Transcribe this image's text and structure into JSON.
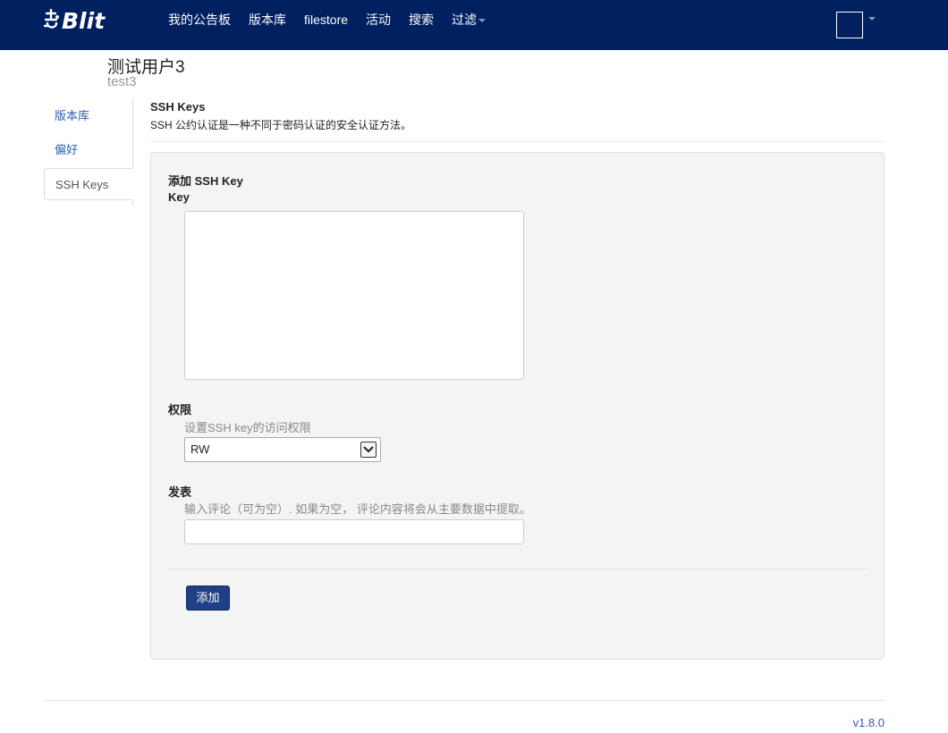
{
  "navbar": {
    "brand": "Blit",
    "items": [
      {
        "label": "我的公告板"
      },
      {
        "label": "版本库"
      },
      {
        "label": "filestore"
      },
      {
        "label": "活动"
      },
      {
        "label": "搜索"
      },
      {
        "label": "过滤"
      }
    ],
    "caret_color": "#8a97b8",
    "background": "#002060"
  },
  "user": {
    "display_name": "测试用户3",
    "username": "test3"
  },
  "side_tabs": [
    {
      "label": "版本库",
      "active": false
    },
    {
      "label": "偏好",
      "active": false
    },
    {
      "label": "SSH Keys",
      "active": true
    }
  ],
  "section": {
    "title": "SSH Keys",
    "description": "SSH 公约认证是一种不同于密码认证的安全认证方法。"
  },
  "form": {
    "title": "添加 SSH Key",
    "key_label": "Key",
    "key_value": "",
    "permission_label": "权限",
    "permission_help": "设置SSH key的访问权限",
    "permission_value": "RW",
    "comment_label": "发表",
    "comment_help": "输入评论（可为空）. 如果为空， 评论内容将会从主要数据中提取。",
    "comment_value": "",
    "submit_label": "添加",
    "submit_color": "#1f3f86"
  },
  "footer": {
    "version": "v1.8.0"
  }
}
